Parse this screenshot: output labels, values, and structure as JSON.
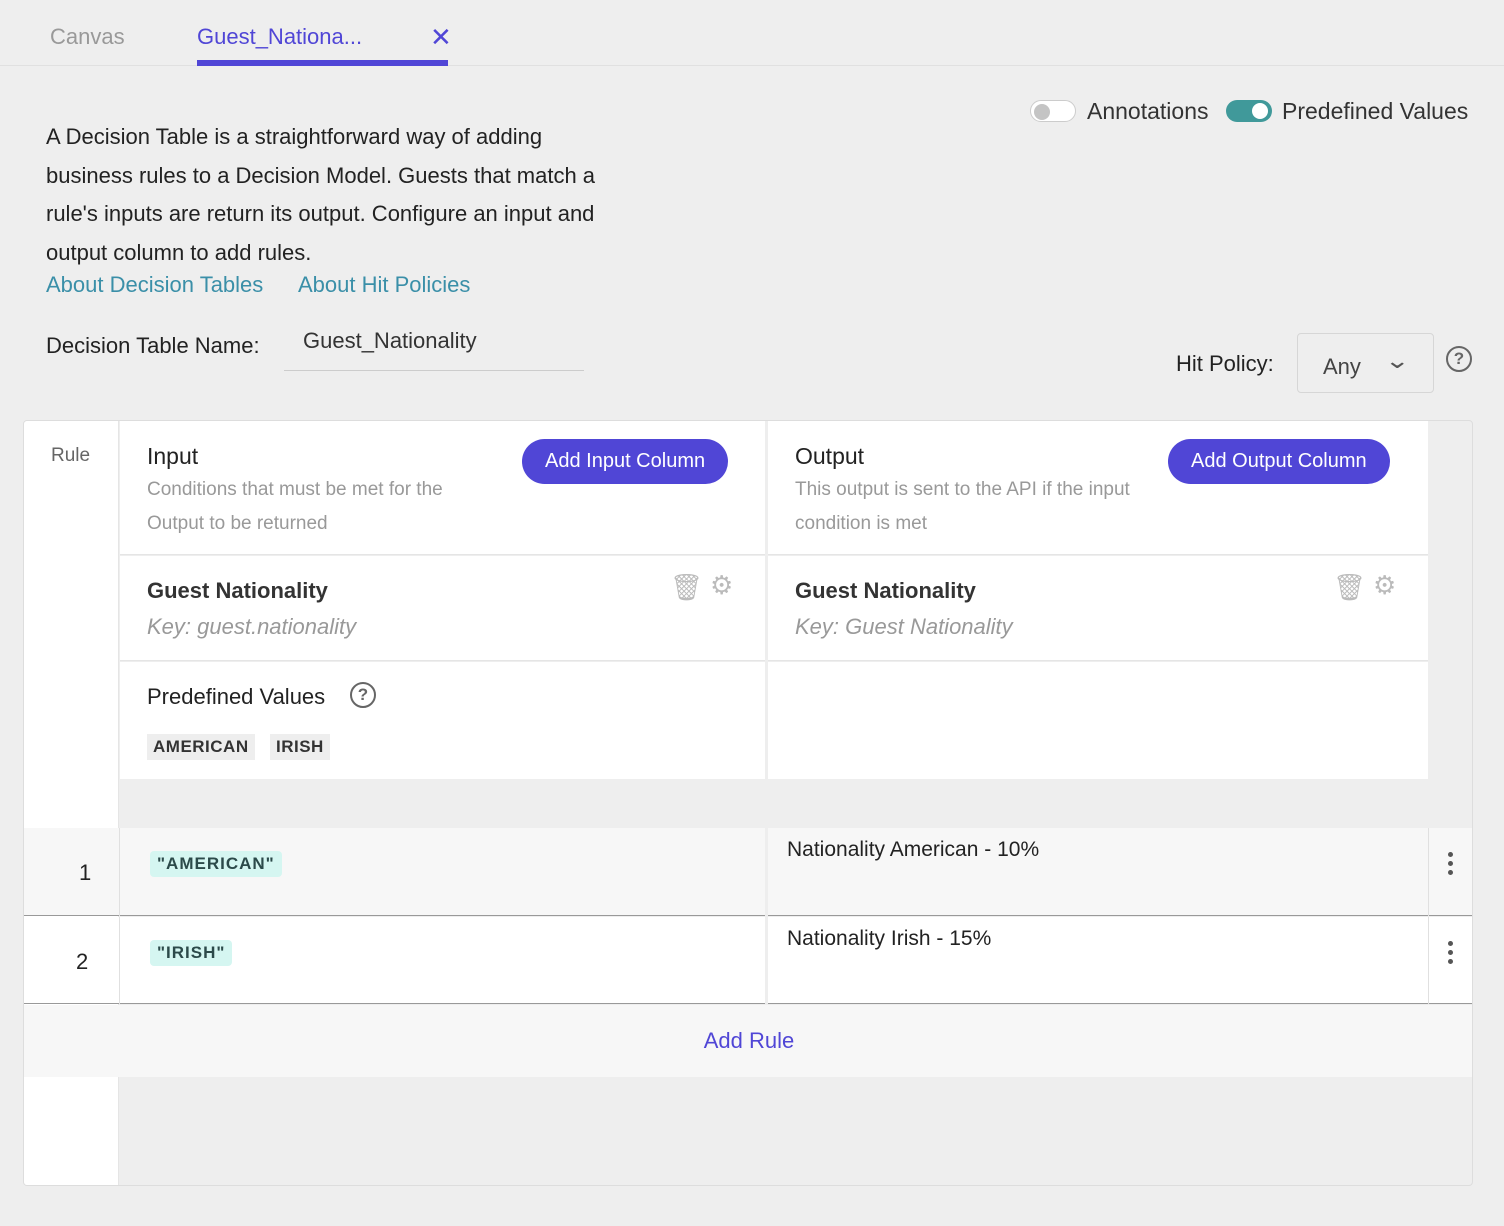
{
  "tabs": [
    {
      "label": "Canvas",
      "active": false
    },
    {
      "label": "Guest_Nationa...",
      "active": true
    }
  ],
  "close_icon": "x-icon",
  "description": "A Decision Table is a straightforward way of adding business rules to a Decision Model. Guests that match a rule's inputs are return its output. Configure an input and output column to add rules.",
  "links": [
    "About Decision Tables",
    "About Hit Policies"
  ],
  "toggles": [
    {
      "label": "Annotations",
      "on": false
    },
    {
      "label": "Predefined Values",
      "on": true
    }
  ],
  "name_label": "Decision Table Name:",
  "name_value": "Guest_Nationality",
  "hit_policy_label": "Hit Policy:",
  "hit_policy_value": "Any",
  "table": {
    "rule_header": "Rule",
    "input": {
      "title": "Input",
      "subtitle": "Conditions that must be met for the Output to be returned",
      "button": "Add Input Column",
      "column_name": "Guest Nationality",
      "column_key": "Key: guest.nationality",
      "predefined_label": "Predefined Values",
      "predefined": [
        "AMERICAN",
        "IRISH"
      ]
    },
    "output": {
      "title": "Output",
      "subtitle": "This output is sent to the API if the input condition is met",
      "button": "Add Output Column",
      "column_name": "Guest Nationality",
      "column_key": "Key: Guest Nationality"
    },
    "rules": [
      {
        "num": "1",
        "input": "\"AMERICAN\"",
        "output": "Nationality American - 10%"
      },
      {
        "num": "2",
        "input": "\"IRISH\"",
        "output": "Nationality Irish - 15%"
      }
    ],
    "add_rule": "Add Rule"
  },
  "colors": {
    "accent": "#5046d6",
    "toggle_on": "#40999a",
    "link": "#3a8fa8",
    "chip_bg": "#d5f6f1"
  }
}
